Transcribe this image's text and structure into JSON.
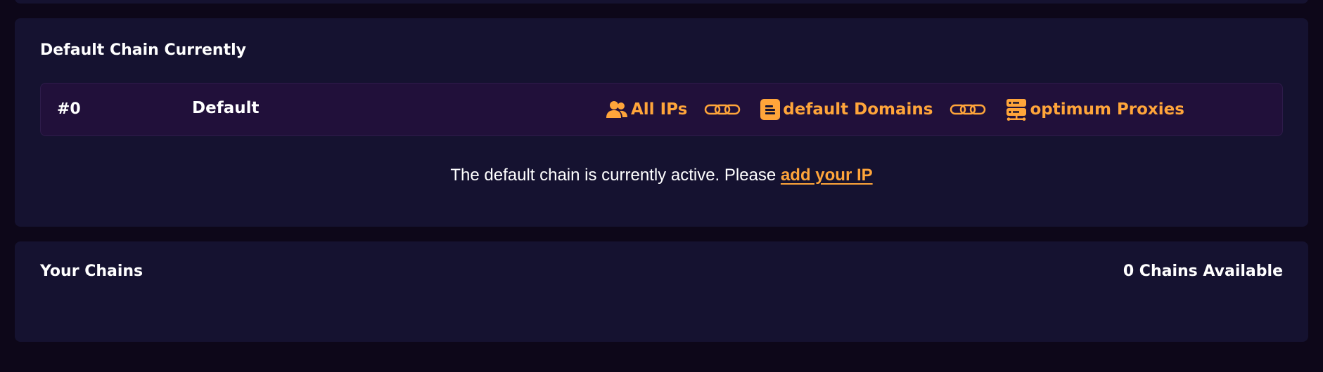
{
  "default_chain": {
    "title": "Default Chain Currently",
    "row": {
      "id": "#0",
      "name": "Default",
      "ips_label": "All IPs",
      "domains_label": "default Domains",
      "proxies_label": "optimum Proxies"
    },
    "notice_text": "The default chain is currently active. Please ",
    "notice_link": " add your IP"
  },
  "your_chains": {
    "title": "Your Chains",
    "count_label": "0 Chains Available"
  },
  "colors": {
    "accent": "#ffa53a",
    "background": "#0d0719",
    "card": "#151230",
    "row": "#21103a"
  }
}
